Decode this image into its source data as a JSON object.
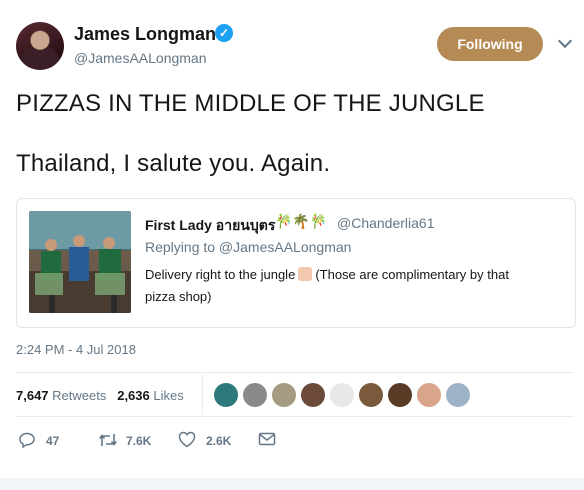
{
  "author": {
    "name": "James Longman",
    "handle": "@JamesAALongman",
    "verified_icon": "verified-badge-icon"
  },
  "follow_button": {
    "label": "Following",
    "color": "#b58a54"
  },
  "tweet": {
    "line1": "PIZZAS IN THE MIDDLE OF THE JUNGLE",
    "line2": "Thailand, I salute you. Again."
  },
  "quoted_tweet": {
    "name": "First Lady อายนบุตร",
    "emoji": "🎋🌴🎋",
    "handle": "@Chanderlia61",
    "replying_to": "Replying to @JamesAALongman",
    "text_part1": "Delivery right to the jungle",
    "text_part2": "(Those are complimentary by that",
    "text_line2": "pizza shop)"
  },
  "timestamp": "2:24 PM - 4 Jul 2018",
  "stats": {
    "retweets_count": "7,647",
    "retweets_label": "Retweets",
    "likes_count": "2,636",
    "likes_label": "Likes"
  },
  "actions": {
    "reply_count": "47",
    "retweet_count": "7.6K",
    "like_count": "2.6K"
  },
  "colors": {
    "accent": "#1da1f2",
    "secondary_text": "#657786"
  }
}
